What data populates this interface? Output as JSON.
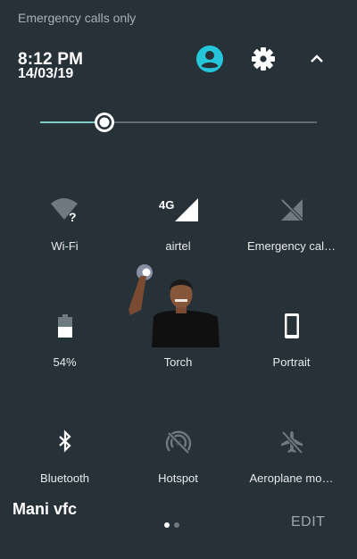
{
  "status_bar": {
    "carrier_text": "Emergency calls only"
  },
  "header": {
    "time": "8:12 PM",
    "date": "14/03/19",
    "icons": [
      "user-avatar-icon",
      "gear-icon",
      "chevron-up-icon"
    ]
  },
  "brightness": {
    "level": 0.22
  },
  "tiles": [
    {
      "label": "Wi-Fi",
      "icon": "wifi-unknown-icon",
      "active": false
    },
    {
      "label": "airtel",
      "icon": "signal-4g-icon",
      "badge": "4G",
      "active": true
    },
    {
      "label": "Emergency cal…",
      "icon": "no-signal-icon",
      "active": false
    },
    {
      "label": "54%",
      "icon": "battery-icon",
      "active": true
    },
    {
      "label": "Torch",
      "icon": "torch-icon",
      "active": false
    },
    {
      "label": "Portrait",
      "icon": "portrait-phone-icon",
      "active": true
    },
    {
      "label": "Bluetooth",
      "icon": "bluetooth-icon",
      "active": true
    },
    {
      "label": "Hotspot",
      "icon": "hotspot-off-icon",
      "active": false
    },
    {
      "label": "Aeroplane mo…",
      "icon": "airplane-off-icon",
      "active": false
    }
  ],
  "watermark": "Mani vfc",
  "pager": {
    "pages": 2,
    "current": 1
  },
  "edit_label": "EDIT",
  "colors": {
    "background": "#263238",
    "accent": "#80cbc4",
    "avatar": "#26c6da",
    "inactive_icon": "#6e7a7f"
  }
}
